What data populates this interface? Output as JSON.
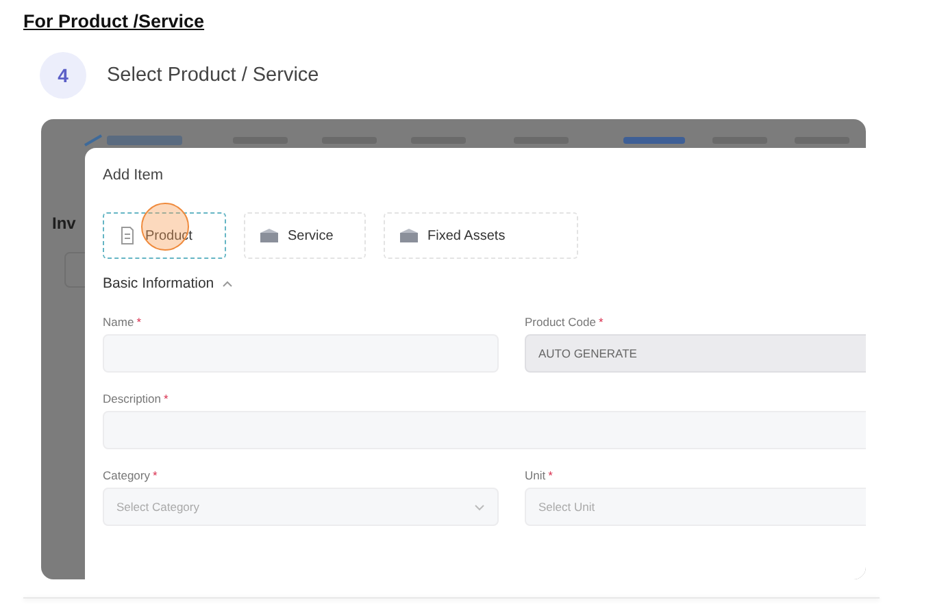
{
  "heading": "For Product /Service",
  "step": {
    "number": "4",
    "title": "Select Product / Service"
  },
  "background_app": {
    "page_title": "Inv"
  },
  "dialog": {
    "title": "Add Item",
    "item_types": [
      {
        "label": "Product",
        "kind": "product",
        "selected": true,
        "tapped": true
      },
      {
        "label": "Service",
        "kind": "service",
        "selected": false,
        "tapped": false
      },
      {
        "label": "Fixed Assets",
        "kind": "assets",
        "selected": false,
        "tapped": false
      }
    ],
    "section": {
      "title": "Basic Information",
      "expanded": true
    },
    "fields": [
      {
        "label": "Name",
        "required_mark": "*",
        "kind": "input",
        "disabled": false
      },
      {
        "label": "Product Code",
        "required_mark": "*",
        "kind": "input",
        "value": "AUTO GENERATE",
        "disabled": true
      },
      {
        "label": "Description",
        "required_mark": "*",
        "kind": "wide_input",
        "disabled": false
      },
      {
        "label": "Category",
        "required_mark": "*",
        "kind": "select",
        "placeholder": "Select Category",
        "disabled": false
      },
      {
        "label": "Unit",
        "required_mark": "*",
        "kind": "input",
        "placeholder": "Select Unit",
        "disabled": false
      }
    ]
  }
}
